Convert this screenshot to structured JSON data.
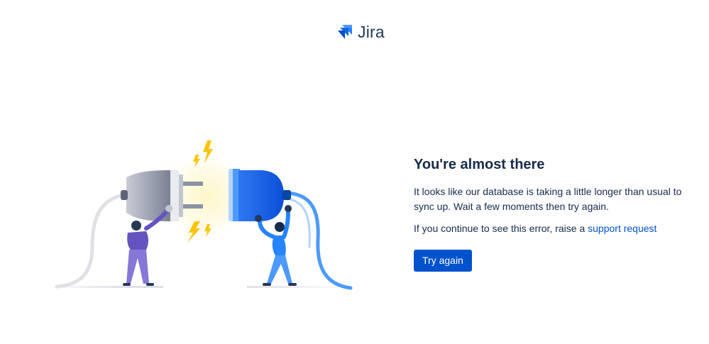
{
  "brand": {
    "name": "Jira",
    "logo_icon": "jira-logo-icon",
    "color": "#2684FF"
  },
  "illustration": {
    "name": "plugs-connecting-illustration"
  },
  "message": {
    "title": "You're almost there",
    "body": "It looks like our database is taking a little longer than usual to sync up. Wait a few moments then try again.",
    "support_prefix": "If you continue to see this error, raise a ",
    "support_link": "support request"
  },
  "actions": {
    "retry_label": "Try again"
  },
  "colors": {
    "primary": "#0052CC",
    "text": "#172B4D",
    "link": "#0052CC"
  }
}
